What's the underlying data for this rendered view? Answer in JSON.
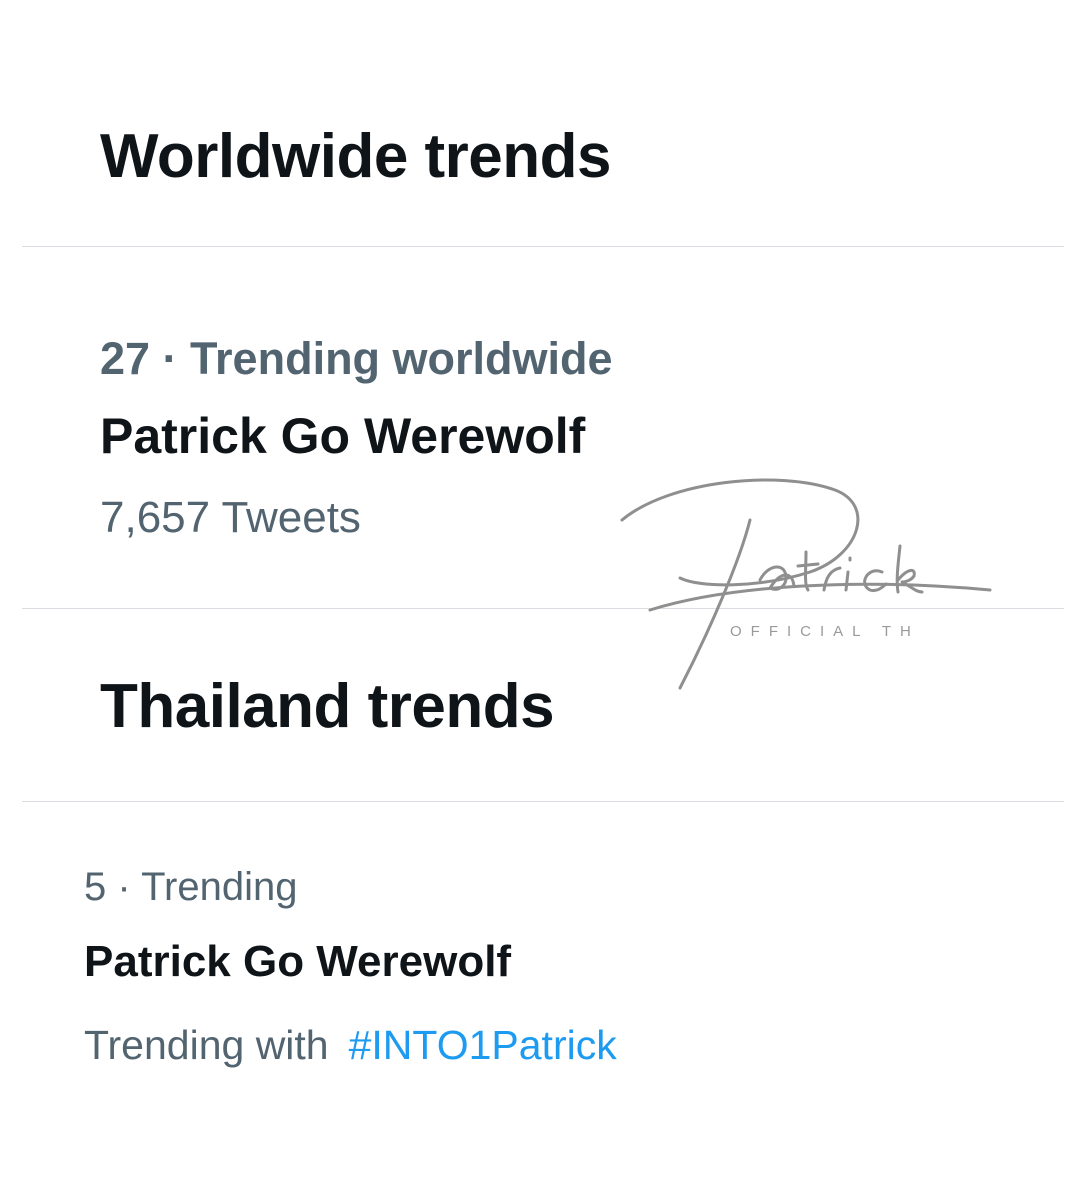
{
  "worldwide": {
    "title": "Worldwide trends",
    "trend": {
      "rank_label": "27 · Trending worldwide",
      "name": "Patrick Go Werewolf",
      "count": "7,657 Tweets"
    }
  },
  "thailand": {
    "title": "Thailand trends",
    "trend": {
      "rank_label": "5 · Trending",
      "name": "Patrick Go Werewolf",
      "with_label": "Trending with",
      "hashtag": "#INTO1Patrick"
    }
  },
  "watermark": {
    "signature": "Patrick",
    "subtitle": "OFFICIAL TH"
  },
  "colors": {
    "text_primary": "#0f1419",
    "text_secondary": "#536471",
    "link": "#1d9bf0",
    "divider": "#d9dde2"
  }
}
